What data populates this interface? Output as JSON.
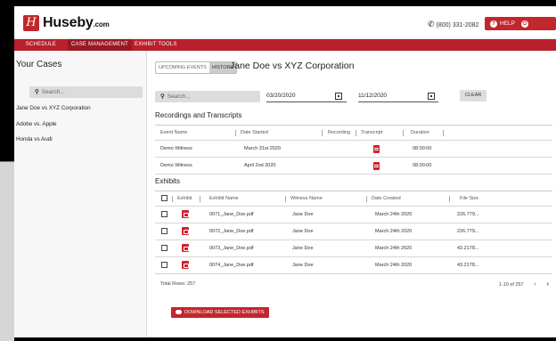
{
  "brand": {
    "name": "Huseby",
    "suffix": ".com",
    "mark": "H"
  },
  "header": {
    "phone": "(800) 331-2082",
    "help_label": "HELP",
    "logout_label": "LOGOUT"
  },
  "nav": {
    "items": [
      {
        "label": "SCHEDULE"
      },
      {
        "label": "CASE MANAGEMENT"
      },
      {
        "label": "EXHIBIT TOOLS"
      }
    ]
  },
  "sidebar": {
    "title": "Your Cases",
    "search_placeholder": "Search...",
    "cases": [
      {
        "label": "Jane Doe vs XYZ Corporation"
      },
      {
        "label": "Adobe vs. Apple"
      },
      {
        "label": "Honda vs Audi"
      }
    ]
  },
  "main": {
    "tabs": [
      {
        "label": "UPCOMING EVENTS"
      },
      {
        "label": "HISTORY"
      }
    ],
    "case_title": "Jane Doe vs XYZ Corporation",
    "filter": {
      "search_placeholder": "Search...",
      "start_date": "03/20/2020",
      "end_date": "11/12/2020",
      "clear_label": "CLEAR"
    },
    "recordings": {
      "title": "Recordings and Transcripts",
      "columns": [
        "Event Name",
        "Date Started",
        "Recording",
        "Transcript",
        "Duration"
      ],
      "rows": [
        {
          "event": "Demo Witness",
          "date": "March 31st 2020",
          "duration": "08:00:00"
        },
        {
          "event": "Demo Witness",
          "date": "April 2nd 2020",
          "duration": "08:00:00"
        }
      ]
    },
    "exhibits": {
      "title": "Exhibits",
      "columns": [
        "Exhibit",
        "Exhibit Name",
        "Witness Name",
        "Date Created",
        "File Size"
      ],
      "rows": [
        {
          "name": "0071_Jane_Doe.pdf",
          "witness": "Jane Doe",
          "date": "March 24th 2020",
          "size": "226.779..."
        },
        {
          "name": "0072_Jane_Doe.pdf",
          "witness": "Jane Doe",
          "date": "March 24th 2020",
          "size": "226.779..."
        },
        {
          "name": "0073_Jane_Doe.pdf",
          "witness": "Jane Doe",
          "date": "March 24th 2020",
          "size": "43.2178..."
        },
        {
          "name": "0074_Jane_Doe.pdf",
          "witness": "Jane Doe",
          "date": "March 24th 2020",
          "size": "43.2178..."
        }
      ],
      "total_rows": "Total Rows: 257",
      "pagination": "1-10 of 257"
    },
    "download_label": "DOWNLOAD SELECTED EXHIBITS"
  },
  "colors": {
    "brand_red": "#c1272d",
    "nav_red": "#b8202c"
  }
}
